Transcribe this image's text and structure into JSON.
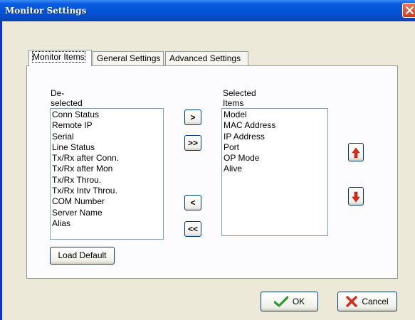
{
  "window": {
    "title": "Monitor Settings"
  },
  "tabs": [
    {
      "label": "Monitor Items"
    },
    {
      "label": "General Settings"
    },
    {
      "label": "Advanced Settings"
    }
  ],
  "deselected": {
    "heading": "De-selected Items",
    "items": [
      "Conn Status",
      "Remote IP",
      "Serial",
      "Line Status",
      "Tx/Rx after Conn.",
      "Tx/Rx after Mon",
      "Tx/Rx Throu.",
      "Tx/Rx Intv Throu.",
      "COM Number",
      "Server Name",
      "Alias"
    ]
  },
  "selected": {
    "heading": "Selected Items",
    "items": [
      "Model",
      "MAC Address",
      "IP Address",
      "Port",
      "OP Mode",
      "Alive"
    ]
  },
  "move_buttons": {
    "add_one": ">",
    "add_all": ">>",
    "remove_one": "<",
    "remove_all": "<<"
  },
  "load_default_label": "Load Default",
  "ok_label": "OK",
  "cancel_label": "Cancel",
  "icons": {
    "close": "close-icon",
    "move_up": "arrow-up-icon",
    "move_down": "arrow-down-icon",
    "ok": "checkmark-icon",
    "cancel": "x-icon"
  },
  "colors": {
    "titlebar": "#0453d6",
    "arrow_red": "#e02a18",
    "check_green": "#2c9a2c",
    "cancel_red": "#d42b1c"
  }
}
